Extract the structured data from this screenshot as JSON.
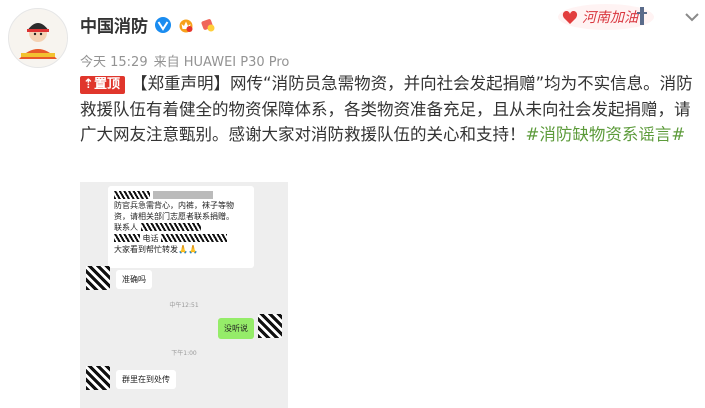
{
  "account": {
    "name": "中国消防",
    "verified_icon": "verified-v-icon",
    "member_icon": "member-crown-icon",
    "fan_icon": "fan-badge-icon"
  },
  "meta": {
    "time": "今天 15:29",
    "source": "来自 HUAWEI P30 Pro"
  },
  "banner": {
    "text": "河南加油",
    "color": "#d9363e"
  },
  "menu_icon": "chevron-down-icon",
  "post": {
    "pin_label": "置顶",
    "text": "【郑重声明】网传“消防员急需物资，并向社会发起捐赠”均为不实信息。消防救援队伍有着健全的物资保障体系，各类物资准备充足，且从未向社会发起捐赠，请广大网友注意甄别。感谢大家对消防救援队伍的关心和支持！",
    "hashtag": "#消防缺物资系谣言#",
    "hashtag_color": "#5d9b3b",
    "pin_color": "#e0362c"
  },
  "screenshot": {
    "msg1_lines": [
      "防官兵急需背心，内裤，袜子等物",
      "资，请相关部门志愿者联系捐赠。",
      "联系人",
      "电话",
      "大家看到帮忙转发🙏🙏"
    ],
    "msg2": "准确吗",
    "time1": "中午12:51",
    "msg3": "没听说",
    "time2": "下午1:00",
    "msg4": "群里在到处传"
  }
}
